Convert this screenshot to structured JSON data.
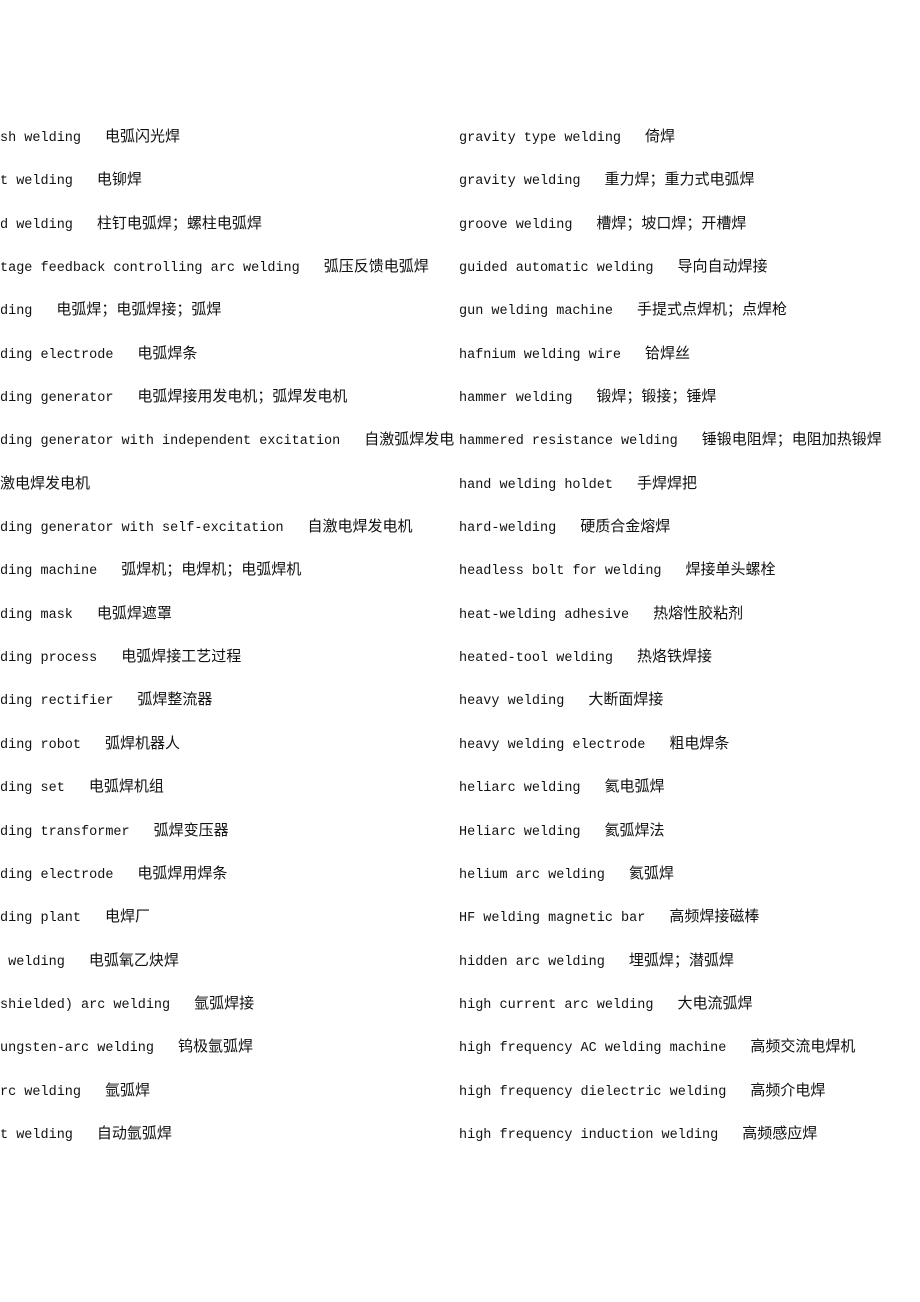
{
  "left_column": [
    {
      "en": "sh welding",
      "zh": "电弧闪光焊"
    },
    {
      "en": "t welding",
      "zh": "电铆焊"
    },
    {
      "en": "d welding",
      "zh": "柱钉电弧焊；螺柱电弧焊"
    },
    {
      "en": "tage feedback controlling arc welding",
      "zh": "弧压反馈电弧焊"
    },
    {
      "en": "ding",
      "zh": "电弧焊；电弧焊接；弧焊"
    },
    {
      "en": "ding electrode",
      "zh": "电弧焊条"
    },
    {
      "en": "ding generator",
      "zh": "电弧焊接用发电机；弧焊发电机"
    },
    {
      "en": "ding generator with independent excitation",
      "zh": "自激弧焊发电"
    },
    {
      "en": "",
      "zh": "激电焊发电机"
    },
    {
      "en": "ding generator with self-excitation",
      "zh": "自激电焊发电机"
    },
    {
      "en": "ding machine",
      "zh": "弧焊机；电焊机；电弧焊机"
    },
    {
      "en": "ding mask",
      "zh": "电弧焊遮罩"
    },
    {
      "en": "ding process",
      "zh": "电弧焊接工艺过程"
    },
    {
      "en": "ding rectifier",
      "zh": "弧焊整流器"
    },
    {
      "en": "ding robot",
      "zh": "弧焊机器人"
    },
    {
      "en": "ding set",
      "zh": "电弧焊机组"
    },
    {
      "en": "ding transformer",
      "zh": "弧焊变压器"
    },
    {
      "en": "ding electrode",
      "zh": "电弧焊用焊条"
    },
    {
      "en": "ding plant",
      "zh": "电焊厂"
    },
    {
      "en": " welding",
      "zh": "电弧氧乙炔焊"
    },
    {
      "en": "shielded) arc welding",
      "zh": "氩弧焊接"
    },
    {
      "en": "ungsten-arc welding",
      "zh": "钨极氩弧焊"
    },
    {
      "en": "rc welding",
      "zh": "氩弧焊"
    },
    {
      "en": "t welding",
      "zh": "自动氩弧焊"
    }
  ],
  "right_column": [
    {
      "en": "gravity type welding",
      "zh": "倚焊"
    },
    {
      "en": "gravity welding",
      "zh": "重力焊；重力式电弧焊"
    },
    {
      "en": "groove welding",
      "zh": "槽焊；坡口焊；开槽焊"
    },
    {
      "en": "guided automatic welding",
      "zh": "导向自动焊接"
    },
    {
      "en": "gun welding machine",
      "zh": "手提式点焊机；点焊枪"
    },
    {
      "en": "hafnium welding wire",
      "zh": "铪焊丝"
    },
    {
      "en": "hammer welding",
      "zh": "锻焊；锻接；锤焊"
    },
    {
      "en": "hammered resistance welding",
      "zh": "锤锻电阻焊；电阻加热锻焊"
    },
    {
      "en": "hand welding holdet",
      "zh": "手焊焊把"
    },
    {
      "en": "hard-welding",
      "zh": "硬质合金熔焊"
    },
    {
      "en": "headless bolt for welding",
      "zh": "焊接单头螺栓"
    },
    {
      "en": "heat-welding adhesive",
      "zh": "热熔性胶粘剂"
    },
    {
      "en": "heated-tool welding",
      "zh": "热烙铁焊接"
    },
    {
      "en": "heavy welding",
      "zh": "大断面焊接"
    },
    {
      "en": "heavy welding electrode",
      "zh": "粗电焊条"
    },
    {
      "en": "heliarc welding",
      "zh": "氦电弧焊"
    },
    {
      "en": "Heliarc welding",
      "zh": "氦弧焊法"
    },
    {
      "en": "helium arc welding",
      "zh": "氦弧焊"
    },
    {
      "en": "HF welding magnetic bar",
      "zh": "高频焊接磁棒"
    },
    {
      "en": "hidden arc welding",
      "zh": "埋弧焊；潜弧焊"
    },
    {
      "en": "high current arc welding",
      "zh": "大电流弧焊"
    },
    {
      "en": "high frequency AC welding machine",
      "zh": "高频交流电焊机"
    },
    {
      "en": "high frequency dielectric welding",
      "zh": "高频介电焊"
    },
    {
      "en": "high frequency induction welding",
      "zh": "高频感应焊"
    }
  ]
}
